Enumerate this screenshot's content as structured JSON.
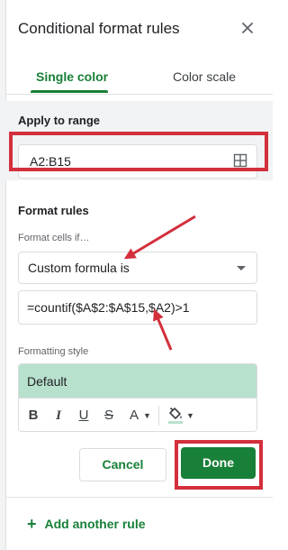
{
  "panel": {
    "title": "Conditional format rules",
    "tabs": [
      {
        "label": "Single color",
        "active": true
      },
      {
        "label": "Color scale",
        "active": false
      }
    ]
  },
  "apply_to_range": {
    "label": "Apply to range",
    "value": "A2:B15",
    "icon": "grid-icon"
  },
  "format_rules": {
    "label": "Format rules",
    "condition_label": "Format cells if…",
    "condition_value": "Custom formula is",
    "formula_value": "=countif($A$2:$A$15,$A2)>1",
    "style_label": "Formatting style",
    "style_preview_text": "Default",
    "style_preview_color": "#b7e1cd",
    "tools": {
      "bold": "B",
      "italic": "I",
      "underline": "U",
      "strikethrough": "S",
      "text_color": "A"
    }
  },
  "actions": {
    "cancel": "Cancel",
    "done": "Done"
  },
  "add_rule": {
    "icon": "+",
    "label": "Add another rule"
  },
  "colors": {
    "accent_green": "#188038",
    "annotation_red": "#d32f3c"
  }
}
